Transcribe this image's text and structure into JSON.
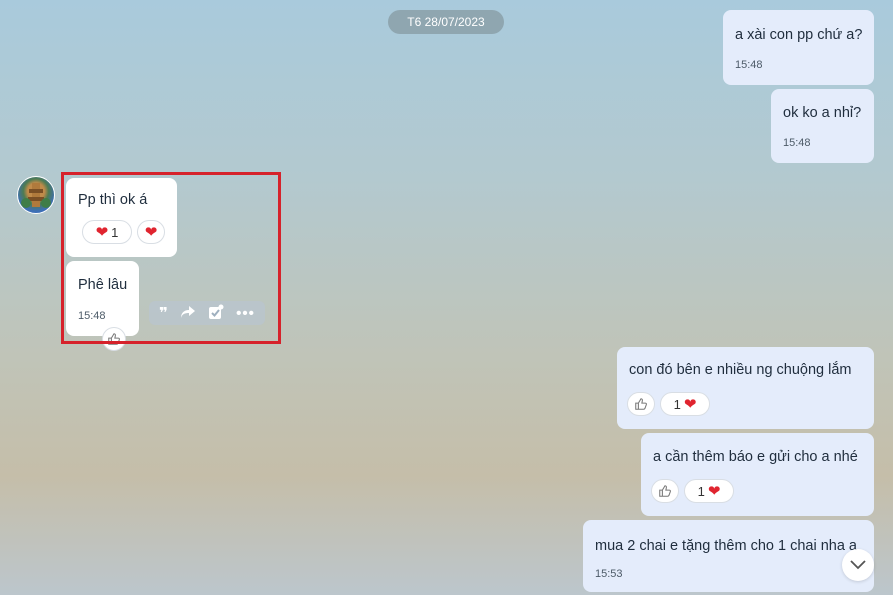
{
  "date_separator": "T6 28/07/2023",
  "messages_out": [
    {
      "text": "a xài con pp chứ a?",
      "time": "15:48"
    },
    {
      "text": "ok ko a nhỉ?",
      "time": "15:48"
    },
    {
      "text": "con đó bên e nhiều ng chuộng lắm",
      "reaction_count": "1"
    },
    {
      "text": "a cần thêm báo e gửi cho a nhé",
      "reaction_count": "1"
    },
    {
      "text": "mua 2 chai e tặng thêm cho 1 chai nha a",
      "time": "15:53"
    }
  ],
  "messages_in": [
    {
      "text": "Pp thì ok á",
      "reaction_count": "1"
    },
    {
      "text": "Phê lâu",
      "time": "15:48"
    }
  ],
  "colors": {
    "highlight": "#d6222b",
    "heart": "#e0242f",
    "outgoing_bubble": "#e4ecfb"
  },
  "icons": [
    "heart-icon",
    "thumbs-up-icon",
    "quote-icon",
    "forward-icon",
    "select-icon",
    "more-icon",
    "chevron-down-icon"
  ]
}
